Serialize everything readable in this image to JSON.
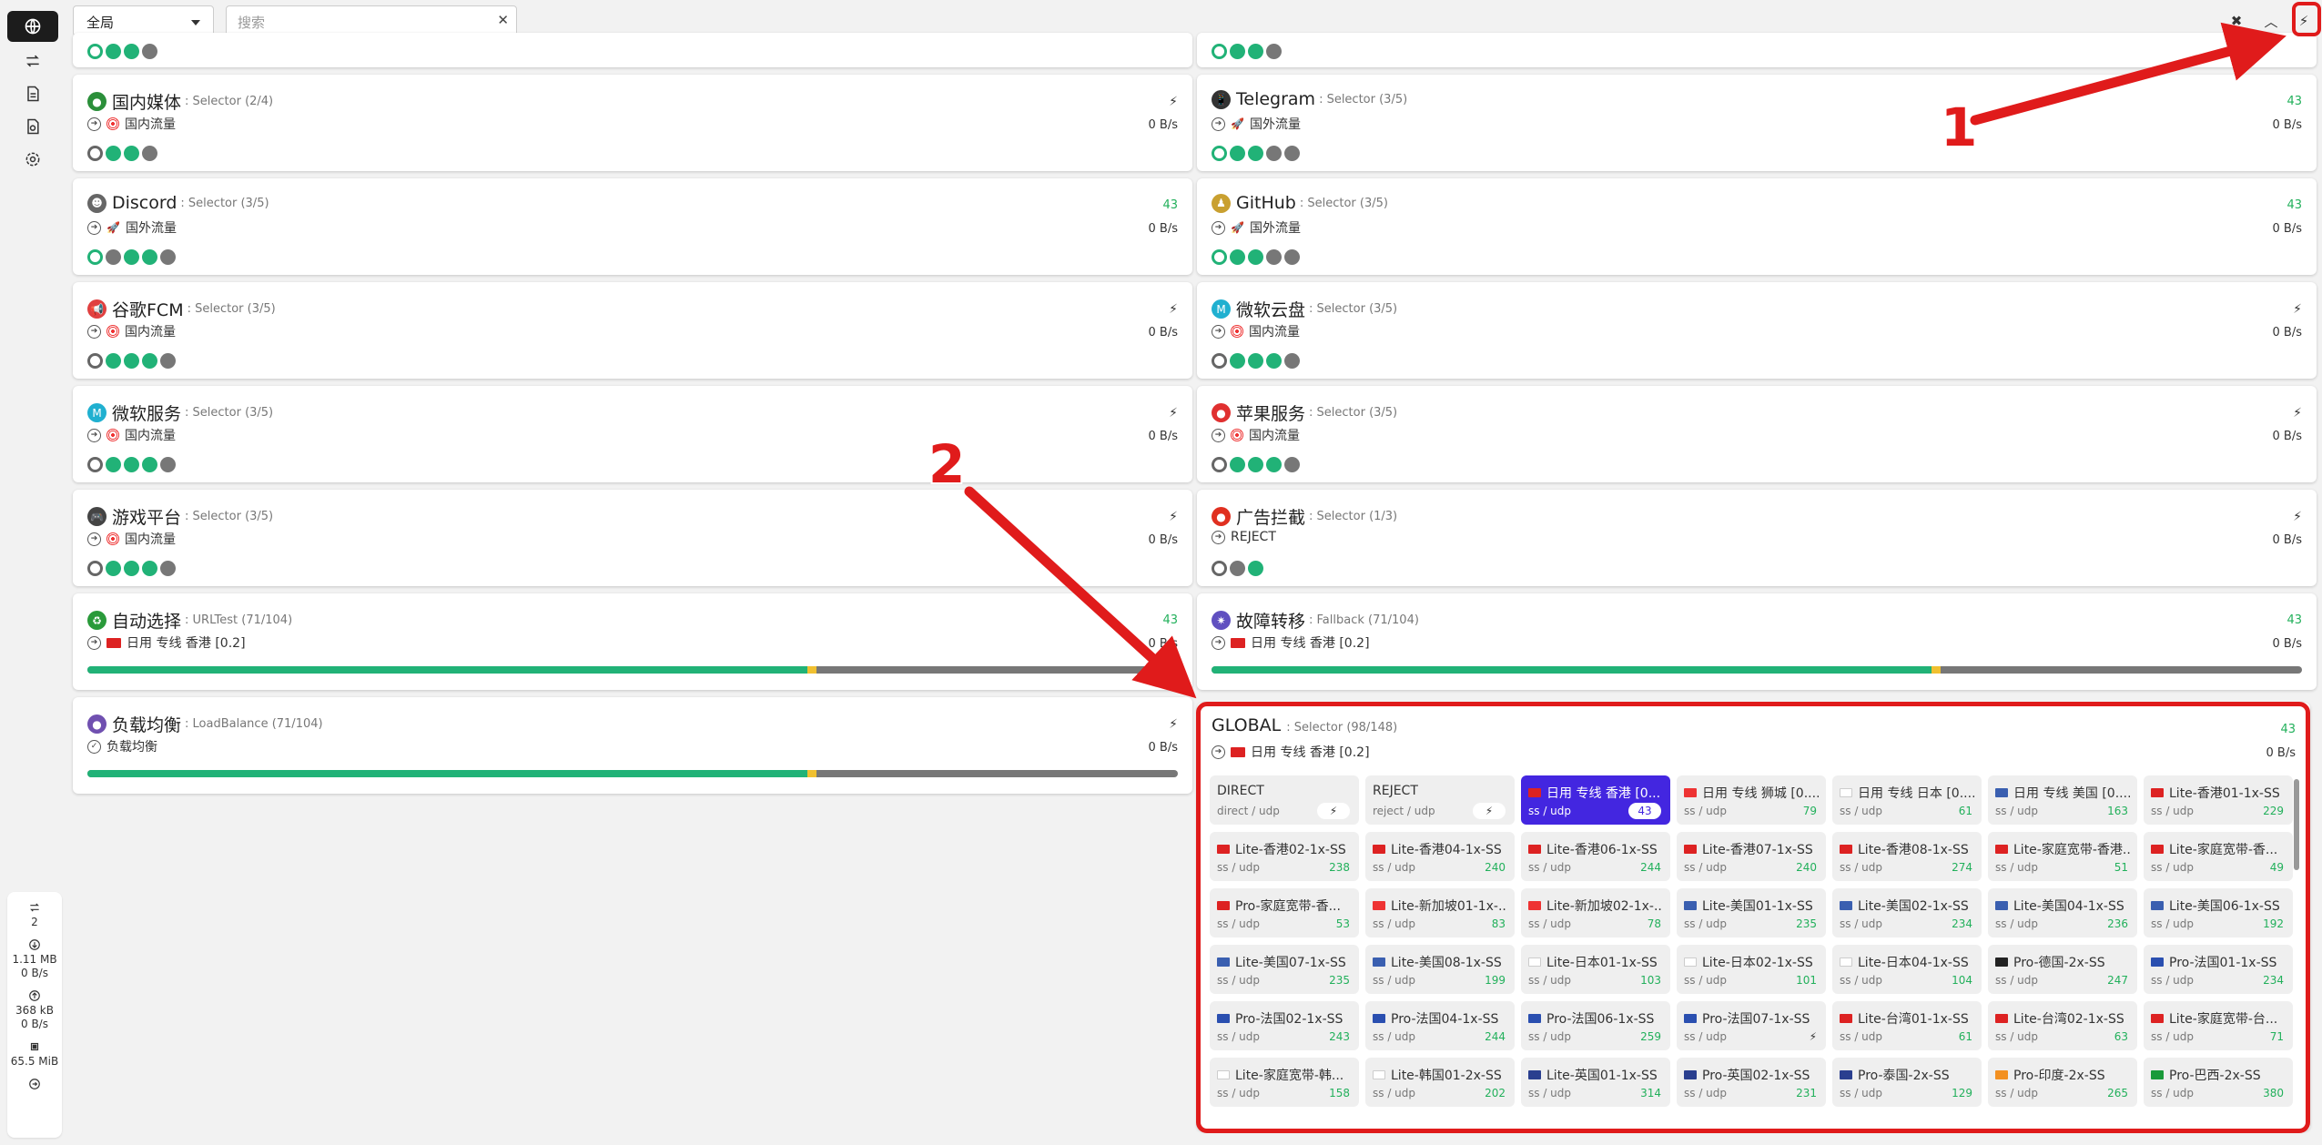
{
  "topbar": {
    "mode_select": "全局",
    "search_placeholder": "搜索"
  },
  "sidebar_stats": {
    "connections": "2",
    "download_total": "1.11 MB",
    "download_speed": "0 B/s",
    "upload_total": "368 kB",
    "upload_speed": "0 B/s",
    "memory": "65.5 MiB"
  },
  "groups": [
    {
      "name": "国内媒体",
      "type": ": Selector (2/4)",
      "sub": "国内流量",
      "sub_icon": "target",
      "right": "⚡",
      "speed": "0 B/s",
      "dots": [
        "ring",
        "g",
        "g",
        "gray"
      ],
      "emoji_color": "#2b8f3a",
      "emoji": "●"
    },
    {
      "name": "Telegram",
      "type": ": Selector (3/5)",
      "sub": "国外流量",
      "sub_icon": "rocket",
      "right": "43",
      "speed": "0 B/s",
      "dots": [
        "gring",
        "g",
        "g",
        "gray",
        "gray"
      ],
      "emoji_color": "#333",
      "emoji": "📱"
    },
    {
      "name": "Discord",
      "type": ": Selector (3/5)",
      "sub": "国外流量",
      "sub_icon": "rocket",
      "right": "43",
      "speed": "0 B/s",
      "dots": [
        "gring",
        "gray",
        "g",
        "g",
        "gray"
      ],
      "emoji_color": "#666",
      "emoji": "☻"
    },
    {
      "name": "GitHub",
      "type": ": Selector (3/5)",
      "sub": "国外流量",
      "sub_icon": "rocket",
      "right": "43",
      "speed": "0 B/s",
      "dots": [
        "gring",
        "g",
        "g",
        "gray",
        "gray"
      ],
      "emoji_color": "#c9a030",
      "emoji": "♟"
    },
    {
      "name": "谷歌FCM",
      "type": ": Selector (3/5)",
      "sub": "国内流量",
      "sub_icon": "target",
      "right": "⚡",
      "speed": "0 B/s",
      "dots": [
        "ring",
        "g",
        "g",
        "g",
        "gray"
      ],
      "emoji_color": "#e04040",
      "emoji": "📢"
    },
    {
      "name": "微软云盘",
      "type": ": Selector (3/5)",
      "sub": "国内流量",
      "sub_icon": "target",
      "right": "⚡",
      "speed": "0 B/s",
      "dots": [
        "ring",
        "g",
        "g",
        "g",
        "gray"
      ],
      "emoji_color": "#20b0d0",
      "emoji": "M"
    },
    {
      "name": "微软服务",
      "type": ": Selector (3/5)",
      "sub": "国内流量",
      "sub_icon": "target",
      "right": "⚡",
      "speed": "0 B/s",
      "dots": [
        "ring",
        "g",
        "g",
        "g",
        "gray"
      ],
      "emoji_color": "#20b0d0",
      "emoji": "M"
    },
    {
      "name": "苹果服务",
      "type": ": Selector (3/5)",
      "sub": "国内流量",
      "sub_icon": "target",
      "right": "⚡",
      "speed": "0 B/s",
      "dots": [
        "ring",
        "g",
        "g",
        "g",
        "gray"
      ],
      "emoji_color": "#e03030",
      "emoji": "●"
    },
    {
      "name": "游戏平台",
      "type": ": Selector (3/5)",
      "sub": "国内流量",
      "sub_icon": "target",
      "right": "⚡",
      "speed": "0 B/s",
      "dots": [
        "ring",
        "g",
        "g",
        "g",
        "gray"
      ],
      "emoji_color": "#444",
      "emoji": "🎮"
    },
    {
      "name": "广告拦截",
      "type": ": Selector (1/3)",
      "sub": "REJECT",
      "sub_icon": "none",
      "right": "⚡",
      "speed": "0 B/s",
      "dots": [
        "ring",
        "gray",
        "g"
      ],
      "emoji_color": "#e03020",
      "emoji": "●"
    },
    {
      "name": "自动选择",
      "type": ": URLTest (71/104)",
      "sub": "日用 专线 香港 [0.2]",
      "sub_icon": "flag",
      "right": "43",
      "speed": "0 B/s",
      "bar": 0.66,
      "emoji_color": "#2a9a3a",
      "emoji": "♻"
    },
    {
      "name": "故障转移",
      "type": ": Fallback (71/104)",
      "sub": "日用 专线 香港 [0.2]",
      "sub_icon": "flag",
      "right": "43",
      "speed": "0 B/s",
      "bar": 0.66,
      "emoji_color": "#6050c0",
      "emoji": "✷"
    },
    {
      "name": "负载均衡",
      "type": ": LoadBalance (71/104)",
      "sub": "负载均衡",
      "sub_icon": "check",
      "right": "⚡",
      "speed": "0 B/s",
      "bar": 0.66,
      "emoji_color": "#7050b0",
      "emoji": "●"
    }
  ],
  "global": {
    "name": "GLOBAL",
    "type": ": Selector (98/148)",
    "right": "43",
    "speed": "0 B/s",
    "sub": "日用 专线 香港 [0.2]",
    "nodes": [
      {
        "name": "DIRECT",
        "type": "direct / udp",
        "delay": "⚡",
        "flag": "",
        "badge": true
      },
      {
        "name": "REJECT",
        "type": "reject / udp",
        "delay": "⚡",
        "flag": "",
        "badge": true
      },
      {
        "name": "日用 专线 香港 [0...",
        "type": "ss / udp",
        "delay": "43",
        "flag": "#d22",
        "selected": true
      },
      {
        "name": "日用 专线 狮城 [0....",
        "type": "ss / udp",
        "delay": "79",
        "flag": "#e33"
      },
      {
        "name": "日用 专线 日本 [0....",
        "type": "ss / udp",
        "delay": "61",
        "flag": "#fff"
      },
      {
        "name": "日用 专线 美国 [0....",
        "type": "ss / udp",
        "delay": "163",
        "flag": "#3a5fb0"
      },
      {
        "name": "Lite-香港01-1x-SS",
        "type": "ss / udp",
        "delay": "229",
        "flag": "#d22"
      },
      {
        "name": "Lite-香港02-1x-SS",
        "type": "ss / udp",
        "delay": "238",
        "flag": "#d22"
      },
      {
        "name": "Lite-香港04-1x-SS",
        "type": "ss / udp",
        "delay": "240",
        "flag": "#d22"
      },
      {
        "name": "Lite-香港06-1x-SS",
        "type": "ss / udp",
        "delay": "244",
        "flag": "#d22"
      },
      {
        "name": "Lite-香港07-1x-SS",
        "type": "ss / udp",
        "delay": "240",
        "flag": "#d22"
      },
      {
        "name": "Lite-香港08-1x-SS",
        "type": "ss / udp",
        "delay": "274",
        "flag": "#d22"
      },
      {
        "name": "Lite-家庭宽带-香港...",
        "type": "ss / udp",
        "delay": "51",
        "flag": "#d22"
      },
      {
        "name": "Lite-家庭宽带-香...",
        "type": "ss / udp",
        "delay": "49",
        "flag": "#d22"
      },
      {
        "name": "Pro-家庭宽带-香...",
        "type": "ss / udp",
        "delay": "53",
        "flag": "#d22"
      },
      {
        "name": "Lite-新加坡01-1x-...",
        "type": "ss / udp",
        "delay": "83",
        "flag": "#e33"
      },
      {
        "name": "Lite-新加坡02-1x-...",
        "type": "ss / udp",
        "delay": "78",
        "flag": "#e33"
      },
      {
        "name": "Lite-美国01-1x-SS",
        "type": "ss / udp",
        "delay": "235",
        "flag": "#3a5fb0"
      },
      {
        "name": "Lite-美国02-1x-SS",
        "type": "ss / udp",
        "delay": "234",
        "flag": "#3a5fb0"
      },
      {
        "name": "Lite-美国04-1x-SS",
        "type": "ss / udp",
        "delay": "236",
        "flag": "#3a5fb0"
      },
      {
        "name": "Lite-美国06-1x-SS",
        "type": "ss / udp",
        "delay": "192",
        "flag": "#3a5fb0"
      },
      {
        "name": "Lite-美国07-1x-SS",
        "type": "ss / udp",
        "delay": "235",
        "flag": "#3a5fb0"
      },
      {
        "name": "Lite-美国08-1x-SS",
        "type": "ss / udp",
        "delay": "199",
        "flag": "#3a5fb0"
      },
      {
        "name": "Lite-日本01-1x-SS",
        "type": "ss / udp",
        "delay": "103",
        "flag": "#fff"
      },
      {
        "name": "Lite-日本02-1x-SS",
        "type": "ss / udp",
        "delay": "101",
        "flag": "#fff"
      },
      {
        "name": "Lite-日本04-1x-SS",
        "type": "ss / udp",
        "delay": "104",
        "flag": "#fff"
      },
      {
        "name": "Pro-德国-2x-SS",
        "type": "ss / udp",
        "delay": "247",
        "flag": "#222"
      },
      {
        "name": "Pro-法国01-1x-SS",
        "type": "ss / udp",
        "delay": "234",
        "flag": "#2a4fb0"
      },
      {
        "name": "Pro-法国02-1x-SS",
        "type": "ss / udp",
        "delay": "243",
        "flag": "#2a4fb0"
      },
      {
        "name": "Pro-法国04-1x-SS",
        "type": "ss / udp",
        "delay": "244",
        "flag": "#2a4fb0"
      },
      {
        "name": "Pro-法国06-1x-SS",
        "type": "ss / udp",
        "delay": "259",
        "flag": "#2a4fb0"
      },
      {
        "name": "Pro-法国07-1x-SS",
        "type": "ss / udp",
        "delay": "⚡",
        "flag": "#2a4fb0"
      },
      {
        "name": "Lite-台湾01-1x-SS",
        "type": "ss / udp",
        "delay": "61",
        "flag": "#d22"
      },
      {
        "name": "Lite-台湾02-1x-SS",
        "type": "ss / udp",
        "delay": "63",
        "flag": "#d22"
      },
      {
        "name": "Lite-家庭宽带-台...",
        "type": "ss / udp",
        "delay": "71",
        "flag": "#d22"
      },
      {
        "name": "Lite-家庭宽带-韩...",
        "type": "ss / udp",
        "delay": "158",
        "flag": "#fff"
      },
      {
        "name": "Lite-韩国01-2x-SS",
        "type": "ss / udp",
        "delay": "202",
        "flag": "#fff"
      },
      {
        "name": "Lite-英国01-1x-SS",
        "type": "ss / udp",
        "delay": "314",
        "flag": "#2a3f8f"
      },
      {
        "name": "Pro-英国02-1x-SS",
        "type": "ss / udp",
        "delay": "231",
        "flag": "#2a3f8f"
      },
      {
        "name": "Pro-泰国-2x-SS",
        "type": "ss / udp",
        "delay": "129",
        "flag": "#2a3f8f"
      },
      {
        "name": "Pro-印度-2x-SS",
        "type": "ss / udp",
        "delay": "265",
        "flag": "#f39020"
      },
      {
        "name": "Pro-巴西-2x-SS",
        "type": "ss / udp",
        "delay": "380",
        "flag": "#1a9a3a"
      }
    ]
  },
  "annotations": {
    "one": "1",
    "two": "2"
  },
  "colors": {
    "accent": "#4326e0",
    "green": "#22b05b",
    "annotation_red": "#e01b1b"
  }
}
